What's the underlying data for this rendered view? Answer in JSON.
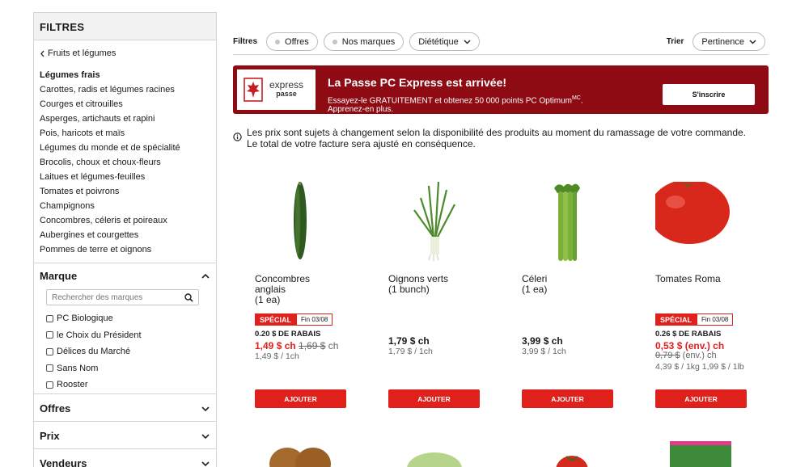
{
  "sidebar": {
    "title": "FILTRES",
    "back_label": "Fruits et légumes",
    "categories": [
      "Légumes frais",
      "Carottes, radis et légumes racines",
      "Courges et citrouilles",
      "Asperges, artichauts et rapini",
      "Pois, haricots et maïs",
      "Légumes du monde et de spécialité",
      "Brocolis, choux et choux-fleurs",
      "Laitues et légumes-feuilles",
      "Tomates et poivrons",
      "Champignons",
      "Concombres, céleris et poireaux",
      "Aubergines et courgettes",
      "Pommes de terre et oignons"
    ],
    "brand": {
      "title": "Marque",
      "search_placeholder": "Rechercher des marques",
      "options": [
        "PC Biologique",
        "le Choix du Président",
        "Délices du Marché",
        "Sans Nom",
        "Rooster"
      ]
    },
    "sections": [
      "Offres",
      "Prix",
      "Vendeurs"
    ]
  },
  "filterbar": {
    "label": "Filtres",
    "chips": [
      "Offres",
      "Nos marques"
    ],
    "dropdown": "Diététique",
    "sort_label": "Trier",
    "sort_value": "Pertinence"
  },
  "banner": {
    "logo_line1": "express",
    "logo_line2": "passe",
    "title": "La Passe PC Express est arrivée!",
    "subtitle": "Essayez-le GRATUITEMENT et obtenez 50 000 points PC Optimum",
    "subtitle_sup": "MC",
    "subtitle_end": ".",
    "subtitle_line2": "Apprenez-en plus.",
    "button": "S'inscrire",
    "color": "#8e0b14"
  },
  "notice": "Les prix sont sujets à changement selon la disponibilité des produits au moment du ramassage de votre commande. Le total de votre facture sera ajusté en conséquence.",
  "products": [
    {
      "name_lines": [
        "Concombres",
        "anglais",
        "(1 ea)"
      ],
      "badge": "SPÉCIAL",
      "badge_end": "Fin 03/08",
      "rabais": "0.20 $ DE RABAIS",
      "sale_price": "1,49 $ ch",
      "old_price": "1,69 $",
      "old_suffix": "ch",
      "unit": "1,49 $ / 1ch",
      "button": "AJOUTER"
    },
    {
      "name_lines": [
        "Oignons verts",
        "(1 bunch)"
      ],
      "price": "1,79 $ ch",
      "unit": "1,79 $ / 1ch",
      "button": "AJOUTER"
    },
    {
      "name_lines": [
        "Céleri",
        "(1 ea)"
      ],
      "price": "3,99 $ ch",
      "unit": "3,99 $ / 1ch",
      "button": "AJOUTER"
    },
    {
      "name_lines": [
        "Tomates Roma"
      ],
      "badge": "SPÉCIAL",
      "badge_end": "Fin 03/08",
      "rabais": "0.26 $ DE RABAIS",
      "sale_price": "0,53 $ (env.) ch",
      "old_price": "0,79 $",
      "old_suffix": "(env.) ch",
      "unit": "4,39 $ / 1kg  1,99 $ / 1lb",
      "button": "AJOUTER"
    }
  ],
  "colors": {
    "accent_red": "#e0201b",
    "banner": "#8e0b14"
  }
}
